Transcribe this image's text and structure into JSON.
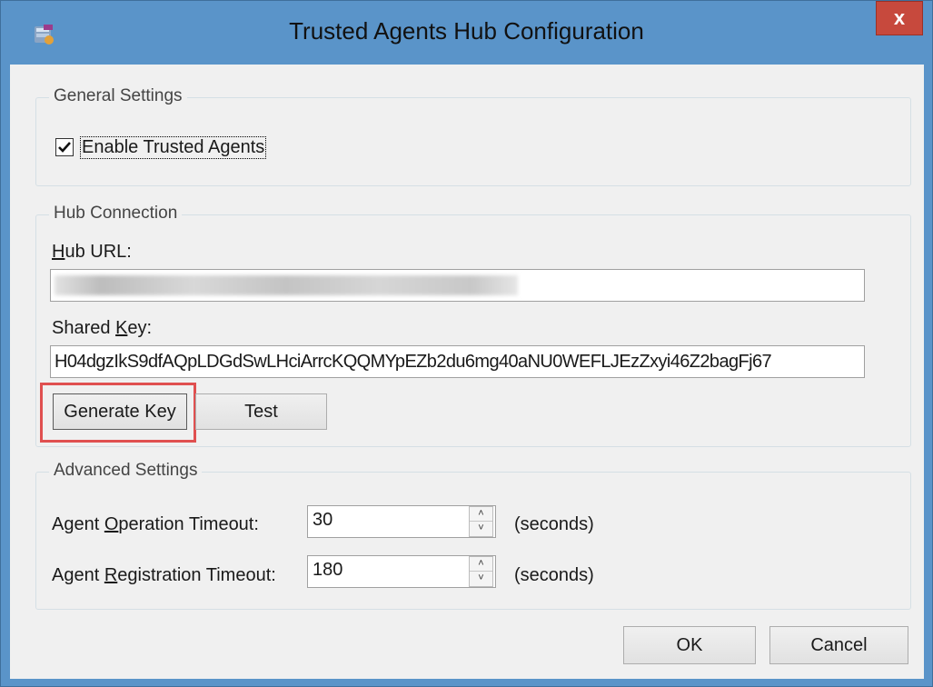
{
  "window": {
    "title": "Trusted Agents Hub Configuration",
    "close_label": "x"
  },
  "general": {
    "group_label": "General Settings",
    "enable_label": "Enable Trusted Agents",
    "enable_checked": true
  },
  "hub": {
    "group_label": "Hub Connection",
    "url_label_first": "H",
    "url_label_rest": "ub URL:",
    "url_value": "",
    "key_label_pre": "Shared ",
    "key_label_u": "K",
    "key_label_post": "ey:",
    "key_value": "H04dgzIkS9dfAQpLDGdSwLHciArrcKQQMYpEZb2du6mg40aNU0WEFLJEzZxyi46Z2bagFj67",
    "generate_button": "Generate Key",
    "test_button": "Test"
  },
  "advanced": {
    "group_label": "Advanced Settings",
    "op_label_pre": "Agent ",
    "op_label_u": "O",
    "op_label_post": "peration Timeout:",
    "op_value": "30",
    "op_unit": "(seconds)",
    "reg_label_pre": "Agent ",
    "reg_label_u": "R",
    "reg_label_post": "egistration Timeout:",
    "reg_value": "180",
    "reg_unit": "(seconds)"
  },
  "footer": {
    "ok_button": "OK",
    "cancel_button": "Cancel"
  },
  "colors": {
    "window_frame": "#5a94c9",
    "close_button": "#c7493d",
    "highlight_box": "#e05050",
    "dialog_bg": "#f0f0f0"
  }
}
